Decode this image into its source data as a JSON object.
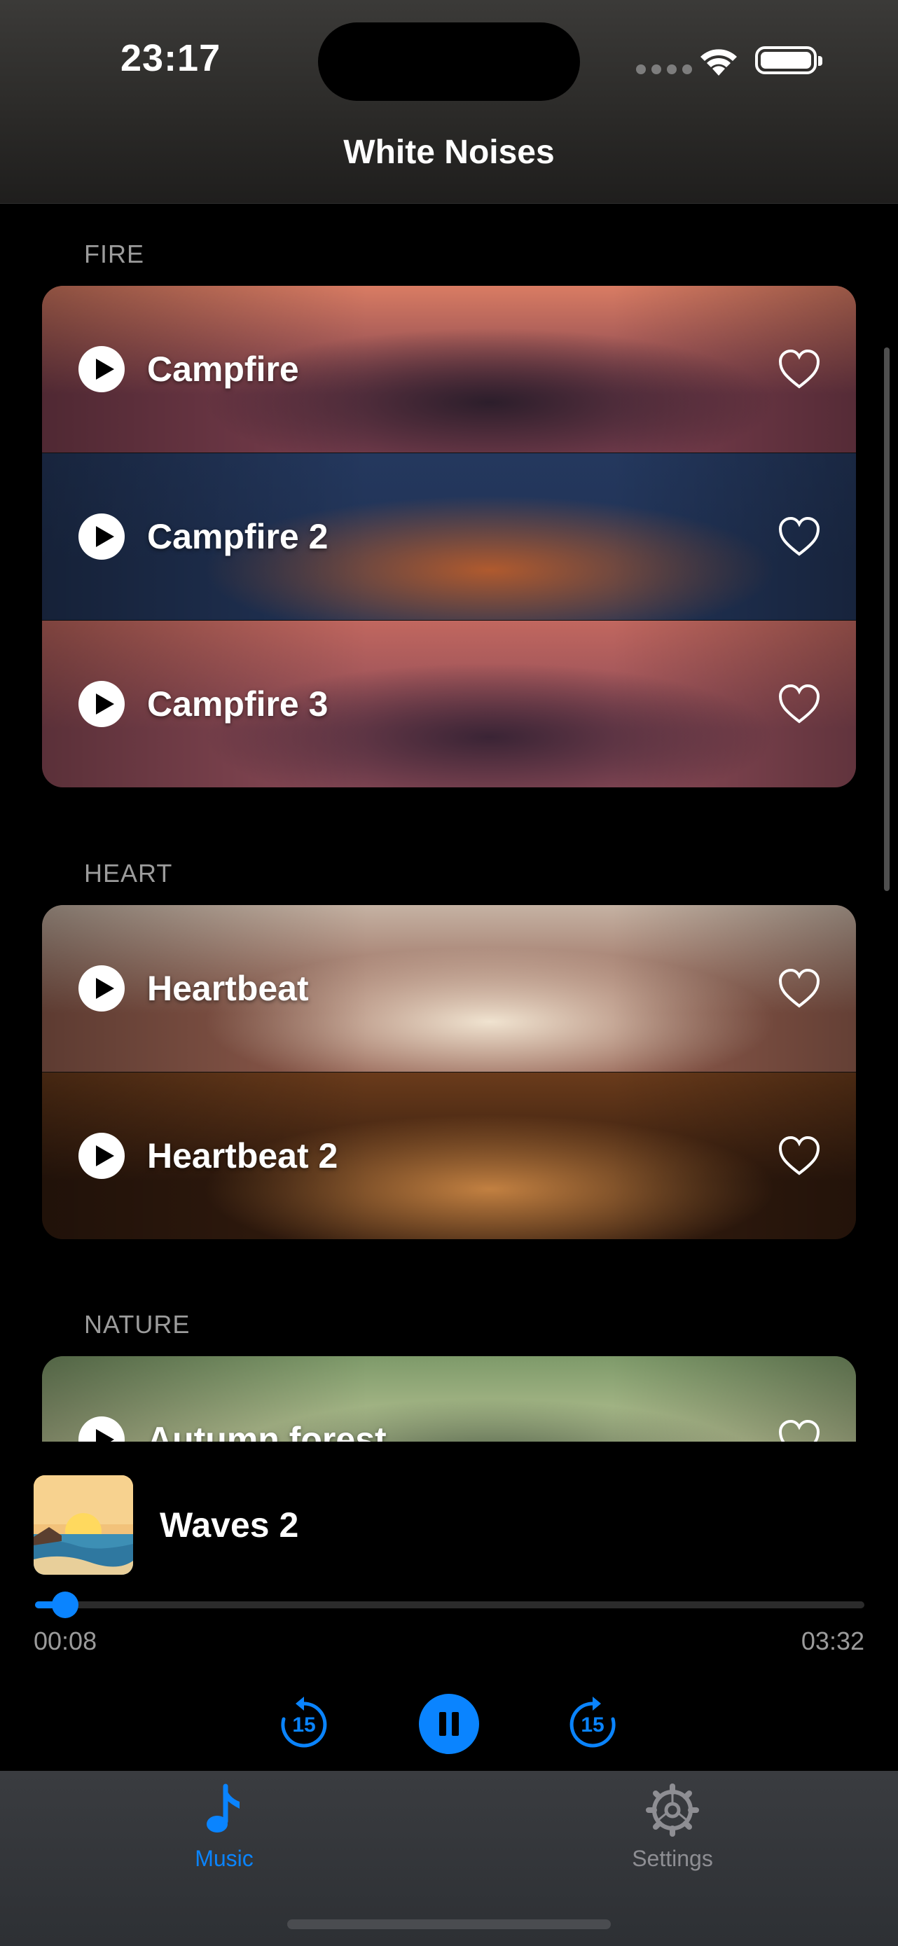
{
  "status_bar": {
    "time": "23:17"
  },
  "nav": {
    "title": "White Noises"
  },
  "sections": [
    {
      "label": "FIRE",
      "items": [
        {
          "label": "Campfire",
          "colors": [
            "#d97c63",
            "#7a3e4e",
            "#2c1e2b"
          ]
        },
        {
          "label": "Campfire 2",
          "colors": [
            "#24385e",
            "#213356",
            "#b05a2e"
          ]
        },
        {
          "label": "Campfire 3",
          "colors": [
            "#c1675f",
            "#8b4a57",
            "#3a2435"
          ]
        }
      ]
    },
    {
      "label": "HEART",
      "items": [
        {
          "label": "Heartbeat",
          "colors": [
            "#c5b2a3",
            "#8f5b4c",
            "#f0e3d0"
          ]
        },
        {
          "label": "Heartbeat 2",
          "colors": [
            "#6a3b1b",
            "#321b0e",
            "#c28041"
          ]
        }
      ]
    },
    {
      "label": "NATURE",
      "items": [
        {
          "label": "Autumn forest",
          "colors": [
            "#7e9a6a",
            "#c8cfa0",
            "#3c4e3a"
          ]
        }
      ]
    }
  ],
  "player": {
    "title": "Waves 2",
    "elapsed": "00:08",
    "duration": "03:32",
    "progress": 0.038,
    "skip_back": "15",
    "skip_forward": "15"
  },
  "tabs": [
    {
      "label": "Music",
      "icon": "music-note-icon",
      "active": true
    },
    {
      "label": "Settings",
      "icon": "gear-icon",
      "active": false
    }
  ],
  "colors": {
    "accent": "#0a84ff",
    "inactive": "#8e8e93"
  }
}
